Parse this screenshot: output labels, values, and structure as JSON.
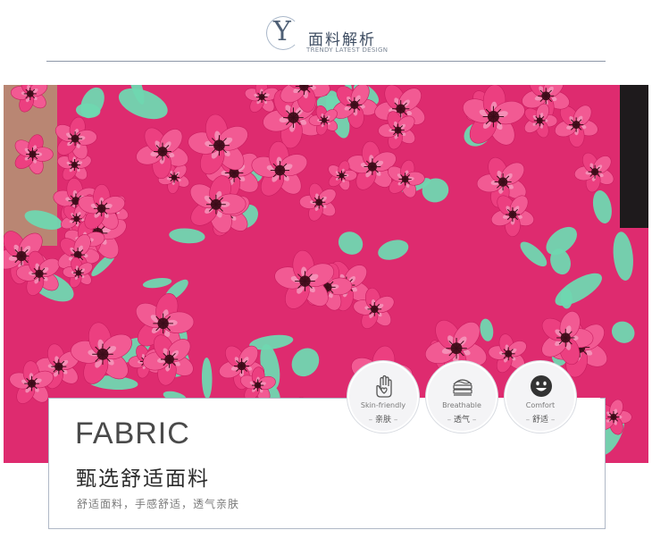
{
  "header": {
    "letter": "Y",
    "title": "面料解析",
    "subtitle": "TRENDY LATEST DESIGN"
  },
  "photo": {
    "description_colors": {
      "base": "#de2b6f",
      "leaf": "#6fd7b0",
      "petal_light": "#f6a3c3"
    }
  },
  "badges": [
    {
      "icon": "hand-heart-icon",
      "en": "Skin-friendly",
      "cn": "亲肤"
    },
    {
      "icon": "fabric-layers-icon",
      "en": "Breathable",
      "cn": "透气"
    },
    {
      "icon": "smiley-face-icon",
      "en": "Comfort",
      "cn": "舒适"
    }
  ],
  "panel": {
    "heading": "FABRIC",
    "title": "甄选舒适面料",
    "description": "舒适面料，手感舒适，透气亲肤"
  }
}
